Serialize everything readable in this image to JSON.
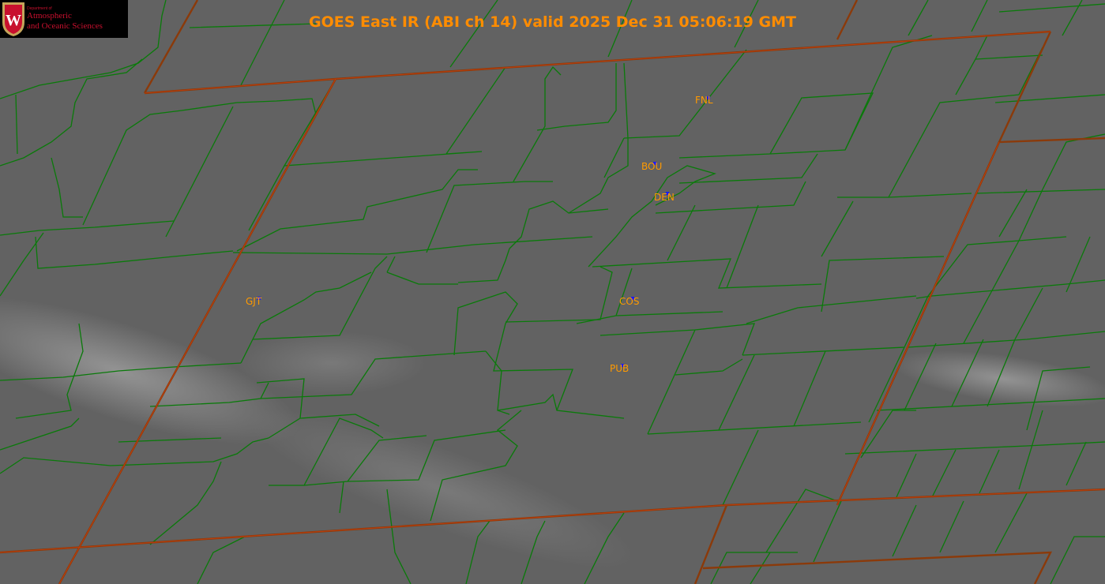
{
  "title": "GOES East IR (ABI ch 14) valid 2025 Dec 31 05:06:19 GMT",
  "logo": {
    "dept": "Department of",
    "line1": "Atmospheric",
    "line2": "and Oceanic Sciences",
    "emblem_letter": "W"
  },
  "stations": [
    {
      "id": "FNL"
    },
    {
      "id": "BOU"
    },
    {
      "id": "DEN"
    },
    {
      "id": "COS"
    },
    {
      "id": "PUB"
    },
    {
      "id": "GJT"
    }
  ],
  "colors": {
    "background": "#5f5f5f",
    "county_lines": "#0a7a0a",
    "state_lines": "#8b3a0a",
    "label": "#ff9a00",
    "station_marker": "#1b1bff"
  }
}
